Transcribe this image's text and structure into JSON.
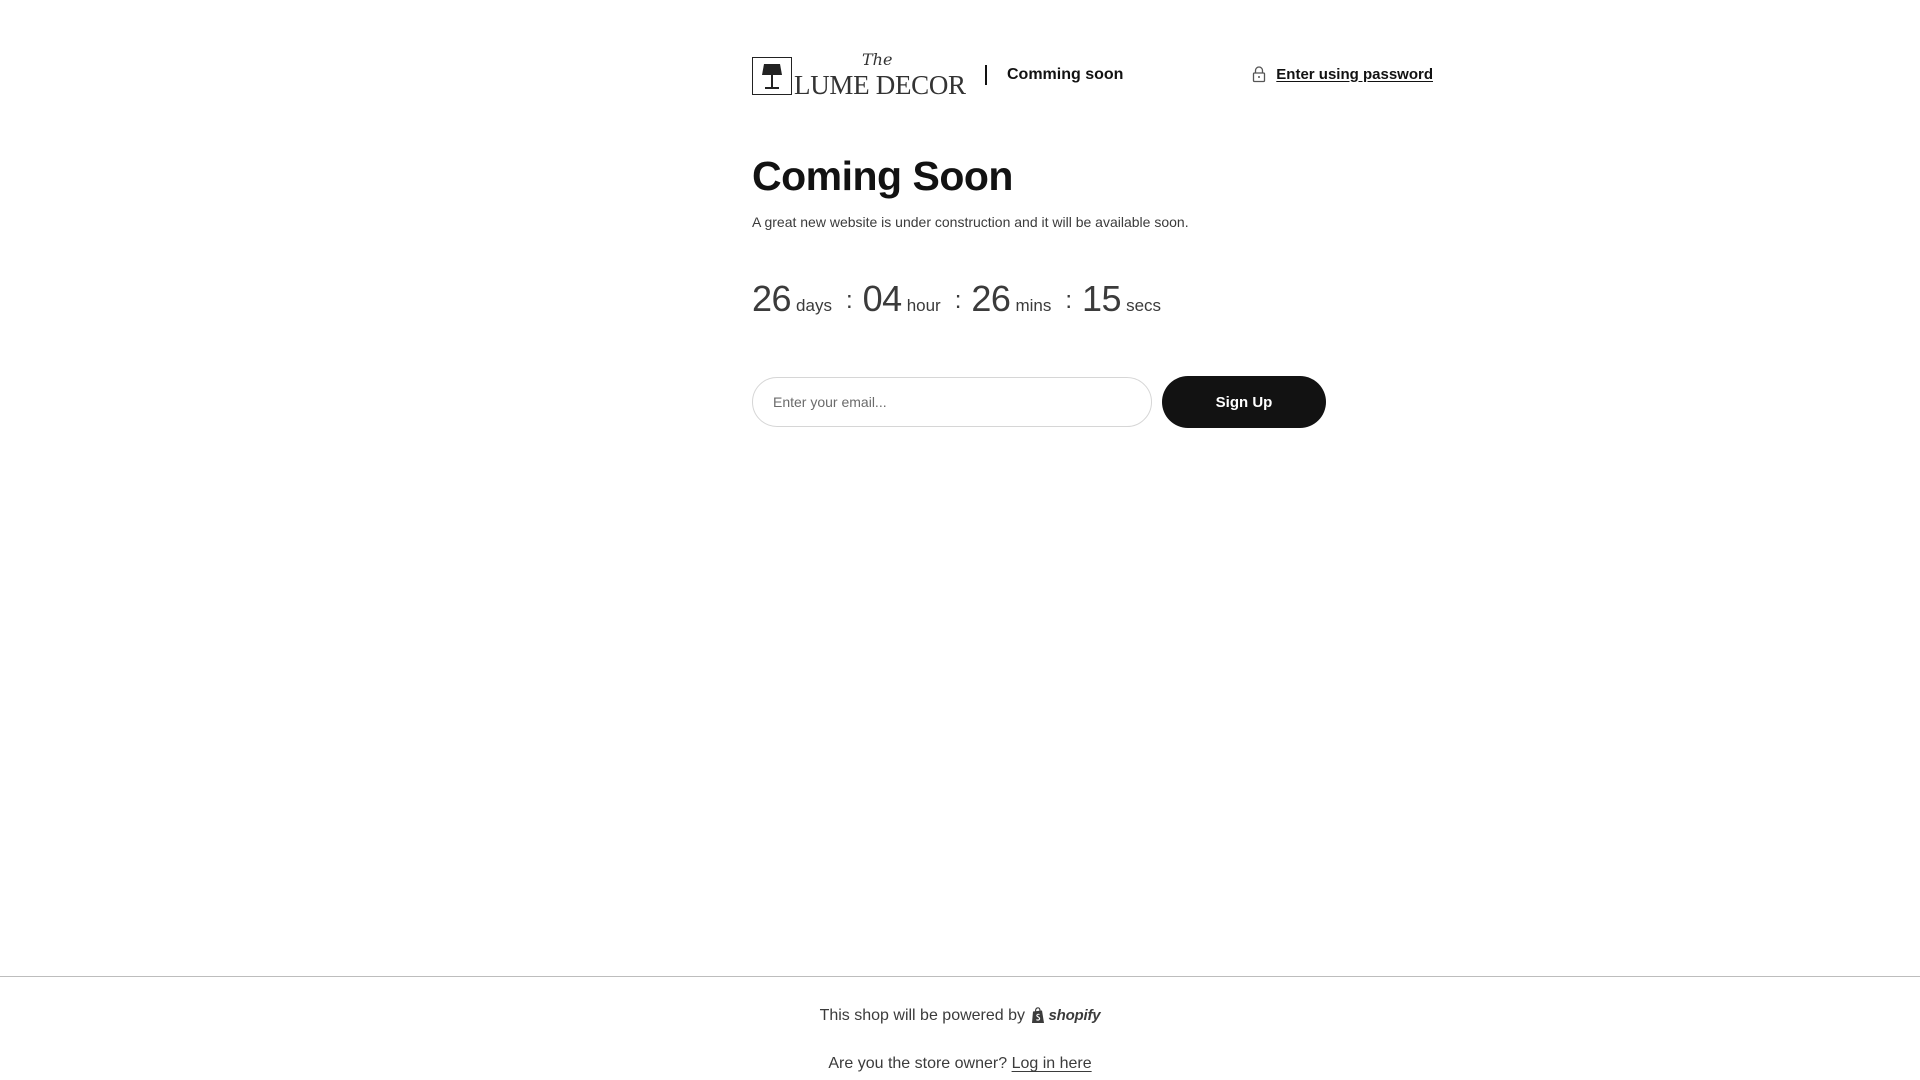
{
  "header": {
    "logo_the": "The",
    "logo_name": "LUME DECOR",
    "logo_icon": "lamp-icon",
    "title": "Comming soon",
    "password_link": "Enter using password",
    "password_icon": "lock-icon"
  },
  "main": {
    "title": "Coming Soon",
    "description": "A great new website is under construction and it will be available soon.",
    "countdown": [
      {
        "value": "26",
        "label": "days"
      },
      {
        "value": "04",
        "label": "hour"
      },
      {
        "value": "26",
        "label": "mins"
      },
      {
        "value": "15",
        "label": "secs"
      }
    ],
    "separator": ":",
    "email_placeholder": "Enter your email...",
    "email_value": "",
    "signup_label": "Sign Up"
  },
  "footer": {
    "powered_text": "This shop will be powered by",
    "shopify_label": "shopify",
    "shopify_icon": "shopify-bag-icon",
    "owner_text": "Are you the store owner?",
    "login_link": "Log in here"
  },
  "colors": {
    "text": "#121212",
    "muted": "#3b3b3b",
    "button_bg": "#121212",
    "button_text": "#ffffff",
    "border": "#d6d6d6"
  }
}
